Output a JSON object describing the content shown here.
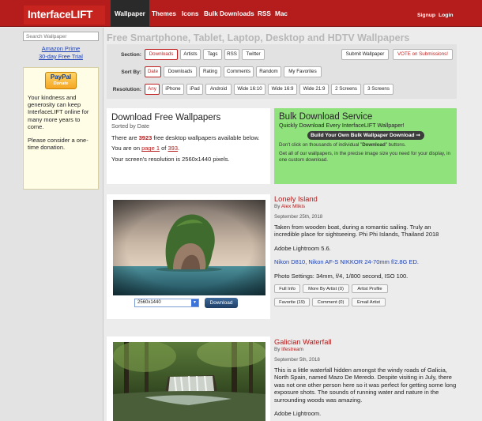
{
  "site": {
    "logo": "InterfaceLIFT",
    "nav": [
      "Wallpaper",
      "Themes",
      "Icons",
      "Bulk Downloads",
      "RSS",
      "Mac"
    ],
    "nav_right": [
      "Signup",
      "Login"
    ]
  },
  "sidebar": {
    "search_placeholder": "Search Wallpaper",
    "link1": "Amazon Prime",
    "link2": "30-day Free Trial",
    "paypal": "PayPal",
    "paypal_sub": "Donate",
    "donate_text": "Your kindness and generosity can keep InterfaceLIFT online for many more years to come.",
    "donate_text2": "Please consider a one-time donation."
  },
  "main": {
    "title": "Free Smartphone, Tablet, Laptop, Desktop and HDTV Wallpapers",
    "filters": {
      "section_label": "Section:",
      "section": [
        "Downloads",
        "Artists",
        "Tags",
        "RSS",
        "Twitter"
      ],
      "submit": "Submit Wallpaper",
      "vote": "VOTE on Submissions!",
      "sort_label": "Sort By:",
      "sort": [
        "Date",
        "Downloads",
        "Rating",
        "Comments",
        "Random",
        "My Favorites"
      ],
      "res_label": "Resolution:",
      "res": [
        "Any",
        "iPhone",
        "iPad",
        "Android",
        "Wide 16:10",
        "Wide 16:9",
        "Wide 21:9",
        "2 Screens",
        "3 Screens"
      ]
    },
    "info": {
      "heading": "Download Free Wallpapers",
      "sub": "Sorted by Date",
      "p1_a": "There are ",
      "count": "3923",
      "p1_b": " free desktop wallpapers available below.",
      "p2_a": "You are on ",
      "page": "page 1",
      "p2_b": " of ",
      "pages": "393",
      "p2_c": ".",
      "p3": "Your screen's resolution is 2560x1440 pixels."
    },
    "bulk": {
      "heading": "Bulk Download Service",
      "sub": "Quickly Download Every InterfaceLIFT Wallpaper!",
      "button": "Build Your Own Bulk Wallpaper Download ➞",
      "p1_a": "Don't click on thousands of individual \"",
      "p1_bold": "Download",
      "p1_b": "\" buttons.",
      "p2": "Get all of our wallpapers, in the precise image size you need for your display, in one custom download."
    },
    "items": [
      {
        "title": "Lonely Island",
        "by": "By ",
        "author": "Alex Mlikis",
        "date": "September 25th, 2018",
        "desc": "Taken from wooden boat, during a romantic sailing. Truly an incredible place for sightseeing. Phi Phi Islands, Thailand 2018",
        "software": "Adobe Lightroom 5.6.",
        "camera": "Nikon D810, Nikon AF-S NIKKOR 24-70mm f/2.8G ED.",
        "settings": "Photo Settings: 34mm, f/4, 1/800 second, ISO 100.",
        "buttons": [
          "Full Info",
          "More By Artist (0)",
          "Artist Profile",
          "Favorite (19)",
          "Comment (0)",
          "Email Artist"
        ],
        "resolution": "2560x1440",
        "download": "Download"
      },
      {
        "title": "Galician Waterfall",
        "by": "By ",
        "author": "lifestream",
        "date": "September 5th, 2018",
        "desc": "This is a little waterfall hidden amongst the windy roads of Galicia, North Spain, named Mazo De Meredo. Despite visiting in July, there was not one other person here so it was perfect for getting some long exposure shots. The sounds of running water and nature in the surrounding woods was amazing.",
        "software": "Adobe Lightroom."
      }
    ]
  }
}
